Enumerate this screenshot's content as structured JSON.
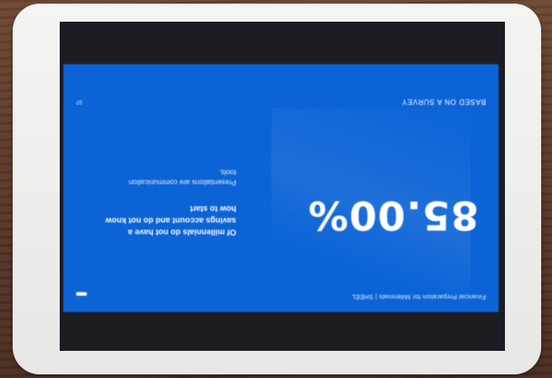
{
  "slide": {
    "header": "Financial Preparation for Millennials | SHEEL",
    "stat": "85.00%",
    "description": "Of millennials do not have a savings account and do not know how to start",
    "subdescription": "Presentations are communication tools.",
    "footer": "BASED ON A SURVEY",
    "page_number": "07"
  },
  "colors": {
    "slide_blue": "#0b63d6",
    "bezel": "#1c1d22",
    "tablet_body": "#eeeeec"
  }
}
